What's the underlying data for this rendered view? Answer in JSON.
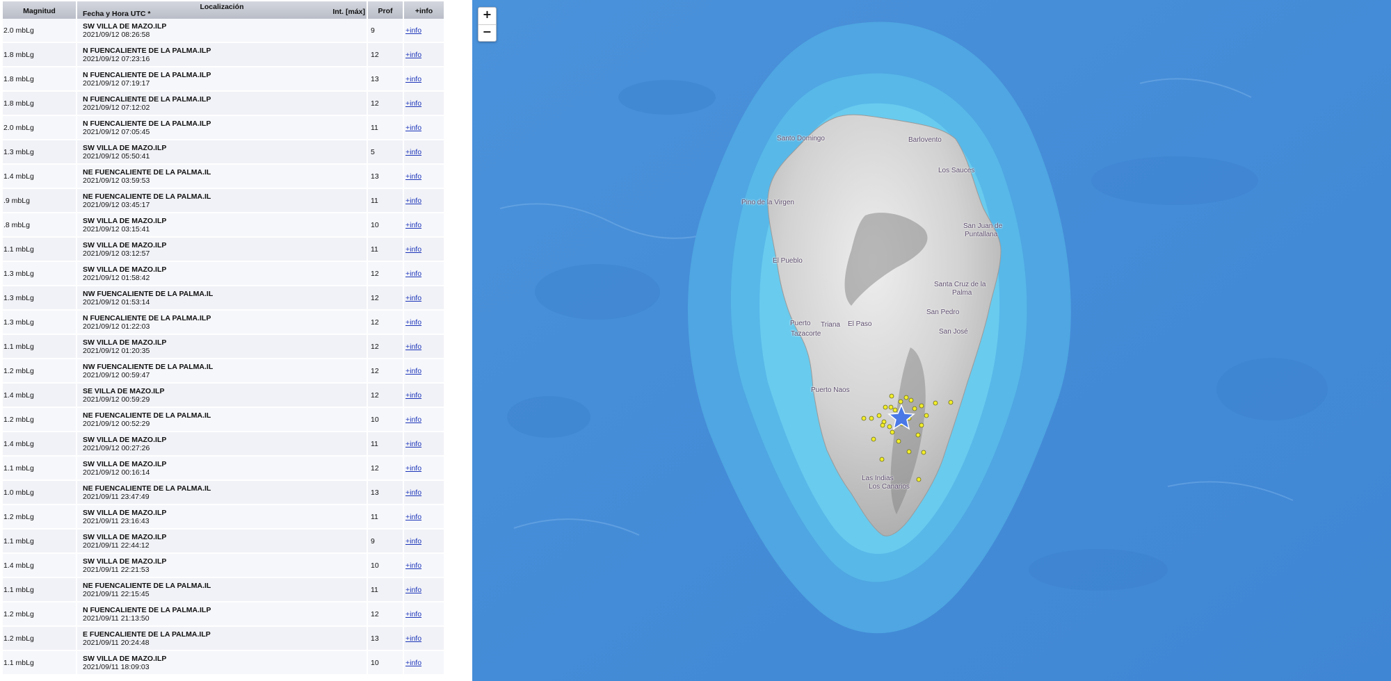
{
  "table": {
    "headers": {
      "magnitude": "Magnitud",
      "location": "Localización",
      "datetime": "Fecha y Hora UTC *",
      "intensity": "Int. [máx]",
      "depth": "Prof",
      "info": "+info"
    },
    "rows": [
      {
        "mag": "2.0 mbLg",
        "place": "SW VILLA DE MAZO.ILP",
        "date": "2021/09/12 08:26:58",
        "prof": "9",
        "info": "+info"
      },
      {
        "mag": "1.8 mbLg",
        "place": "N FUENCALIENTE DE LA PALMA.ILP",
        "date": "2021/09/12 07:23:16",
        "prof": "12",
        "info": "+info"
      },
      {
        "mag": "1.8 mbLg",
        "place": "N FUENCALIENTE DE LA PALMA.ILP",
        "date": "2021/09/12 07:19:17",
        "prof": "13",
        "info": "+info"
      },
      {
        "mag": "1.8 mbLg",
        "place": "N FUENCALIENTE DE LA PALMA.ILP",
        "date": "2021/09/12 07:12:02",
        "prof": "12",
        "info": "+info"
      },
      {
        "mag": "2.0 mbLg",
        "place": "N FUENCALIENTE DE LA PALMA.ILP",
        "date": "2021/09/12 07:05:45",
        "prof": "11",
        "info": "+info"
      },
      {
        "mag": "1.3 mbLg",
        "place": "SW VILLA DE MAZO.ILP",
        "date": "2021/09/12 05:50:41",
        "prof": "5",
        "info": "+info"
      },
      {
        "mag": "1.4 mbLg",
        "place": "NE FUENCALIENTE DE LA PALMA.IL",
        "date": "2021/09/12 03:59:53",
        "prof": "13",
        "info": "+info"
      },
      {
        "mag": ".9 mbLg",
        "place": "NE FUENCALIENTE DE LA PALMA.IL",
        "date": "2021/09/12 03:45:17",
        "prof": "11",
        "info": "+info"
      },
      {
        "mag": ".8 mbLg",
        "place": "SW VILLA DE MAZO.ILP",
        "date": "2021/09/12 03:15:41",
        "prof": "10",
        "info": "+info"
      },
      {
        "mag": "1.1 mbLg",
        "place": "SW VILLA DE MAZO.ILP",
        "date": "2021/09/12 03:12:57",
        "prof": "11",
        "info": "+info"
      },
      {
        "mag": "1.3 mbLg",
        "place": "SW VILLA DE MAZO.ILP",
        "date": "2021/09/12 01:58:42",
        "prof": "12",
        "info": "+info"
      },
      {
        "mag": "1.3 mbLg",
        "place": "NW FUENCALIENTE DE LA PALMA.IL",
        "date": "2021/09/12 01:53:14",
        "prof": "12",
        "info": "+info"
      },
      {
        "mag": "1.3 mbLg",
        "place": "N FUENCALIENTE DE LA PALMA.ILP",
        "date": "2021/09/12 01:22:03",
        "prof": "12",
        "info": "+info"
      },
      {
        "mag": "1.1 mbLg",
        "place": "SW VILLA DE MAZO.ILP",
        "date": "2021/09/12 01:20:35",
        "prof": "12",
        "info": "+info"
      },
      {
        "mag": "1.2 mbLg",
        "place": "NW FUENCALIENTE DE LA PALMA.IL",
        "date": "2021/09/12 00:59:47",
        "prof": "12",
        "info": "+info"
      },
      {
        "mag": "1.4 mbLg",
        "place": "SE VILLA DE MAZO.ILP",
        "date": "2021/09/12 00:59:29",
        "prof": "12",
        "info": "+info"
      },
      {
        "mag": "1.2 mbLg",
        "place": "NE FUENCALIENTE DE LA PALMA.IL",
        "date": "2021/09/12 00:52:29",
        "prof": "10",
        "info": "+info"
      },
      {
        "mag": "1.4 mbLg",
        "place": "SW VILLA DE MAZO.ILP",
        "date": "2021/09/12 00:27:26",
        "prof": "11",
        "info": "+info"
      },
      {
        "mag": "1.1 mbLg",
        "place": "SW VILLA DE MAZO.ILP",
        "date": "2021/09/12 00:16:14",
        "prof": "12",
        "info": "+info"
      },
      {
        "mag": "1.0 mbLg",
        "place": "NE FUENCALIENTE DE LA PALMA.IL",
        "date": "2021/09/11 23:47:49",
        "prof": "13",
        "info": "+info"
      },
      {
        "mag": "1.2 mbLg",
        "place": "SW VILLA DE MAZO.ILP",
        "date": "2021/09/11 23:16:43",
        "prof": "11",
        "info": "+info"
      },
      {
        "mag": "1.1 mbLg",
        "place": "SW VILLA DE MAZO.ILP",
        "date": "2021/09/11 22:44:12",
        "prof": "9",
        "info": "+info"
      },
      {
        "mag": "1.4 mbLg",
        "place": "SW VILLA DE MAZO.ILP",
        "date": "2021/09/11 22:21:53",
        "prof": "10",
        "info": "+info"
      },
      {
        "mag": "1.1 mbLg",
        "place": "NE FUENCALIENTE DE LA PALMA.IL",
        "date": "2021/09/11 22:15:45",
        "prof": "11",
        "info": "+info"
      },
      {
        "mag": "1.2 mbLg",
        "place": "N FUENCALIENTE DE LA PALMA.ILP",
        "date": "2021/09/11 21:13:50",
        "prof": "12",
        "info": "+info"
      },
      {
        "mag": "1.2 mbLg",
        "place": "E FUENCALIENTE DE LA PALMA.ILP",
        "date": "2021/09/11 20:24:48",
        "prof": "13",
        "info": "+info"
      },
      {
        "mag": "1.1 mbLg",
        "place": "SW VILLA DE MAZO.ILP",
        "date": "2021/09/11 18:09:03",
        "prof": "10",
        "info": "+info"
      }
    ]
  },
  "map": {
    "zoom_in": "+",
    "zoom_out": "−",
    "towns": {
      "santo_domingo": "Santo Domingo",
      "barlovento": "Barlovento",
      "los_sauces": "Los Sauces",
      "pino_de_la_virgen": "Pino de la Virgen",
      "san_juan_line1": "San Juan de",
      "san_juan_line2": "Puntallana",
      "el_pueblo": "El Pueblo",
      "santa_cruz_line1": "Santa Cruz de la",
      "santa_cruz_line2": "Palma",
      "san_pedro": "San Pedro",
      "puerto_line1": "Puerto",
      "puerto_line2": "Tazacorte",
      "triana": "Triana",
      "el_paso": "El Paso",
      "san_jose": "San José",
      "puerto_naos": "Puerto Naos",
      "las_indias": "Las Indias",
      "los_canarios": "Los Canarios"
    },
    "colors": {
      "ocean_deep": "#4f96dc",
      "shelf": "#5ec2ea",
      "land": "#d8d8d8",
      "quake_marker": "#f2ee2a",
      "star_marker": "#4a78e6"
    }
  }
}
